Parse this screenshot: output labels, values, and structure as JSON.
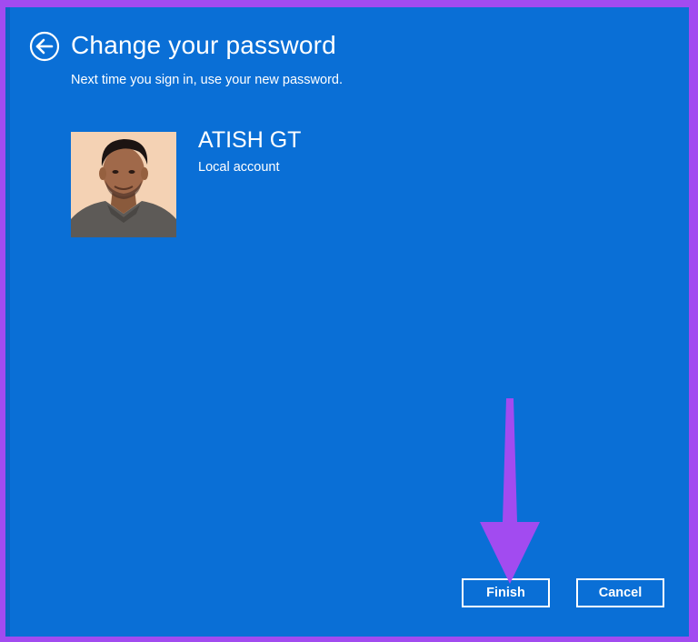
{
  "dialog": {
    "title": "Change your password",
    "subtitle": "Next time you sign in, use your new password."
  },
  "account": {
    "name": "ATISH GT",
    "type": "Local account",
    "avatar_alt": "user-avatar"
  },
  "buttons": {
    "finish_label": "Finish",
    "cancel_label": "Cancel"
  },
  "icons": {
    "back": "back-arrow-icon",
    "annotation": "pointer-arrow"
  },
  "colors": {
    "background": "#0a6fd6",
    "accent_border": "#a24bf0",
    "annotation_arrow": "#a24bf0",
    "text": "#ffffff"
  }
}
